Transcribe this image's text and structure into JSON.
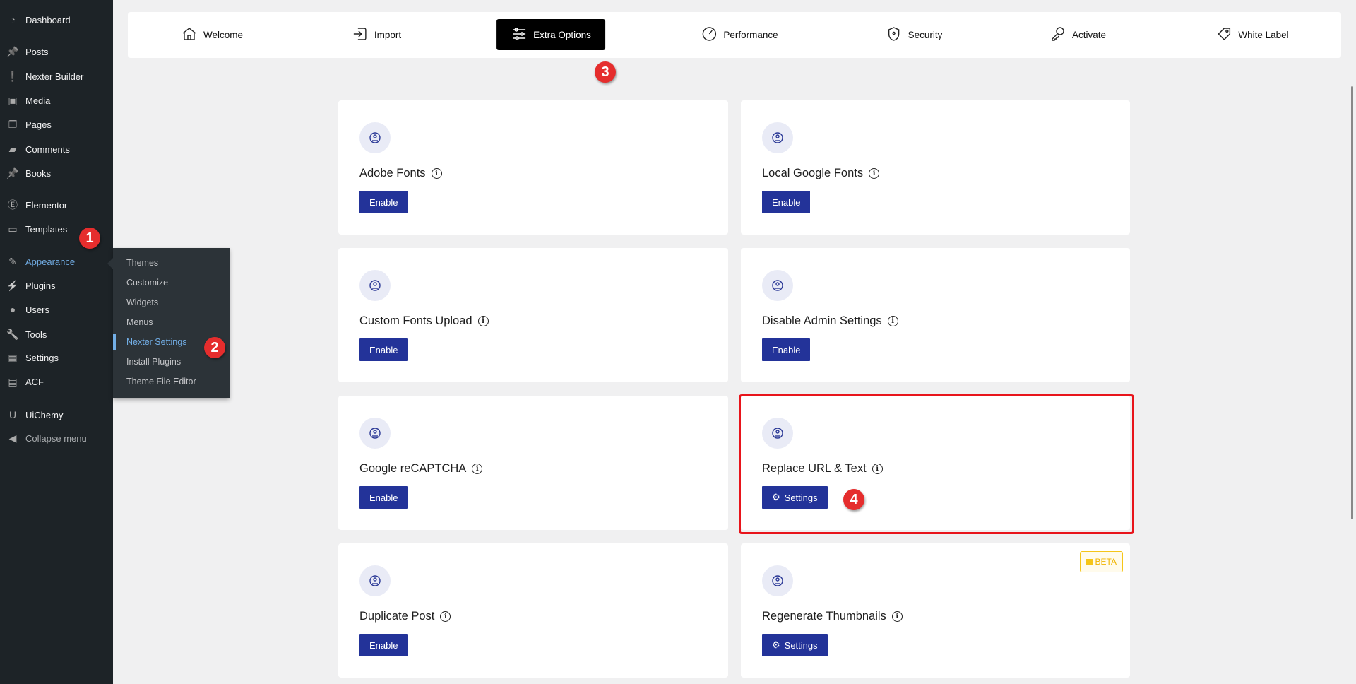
{
  "sidebar": {
    "items": [
      {
        "label": "Dashboard",
        "icon": "dashboard-icon"
      },
      {
        "label": "Posts",
        "icon": "pin-icon"
      },
      {
        "label": "Nexter Builder",
        "icon": "nexter-icon"
      },
      {
        "label": "Media",
        "icon": "media-icon"
      },
      {
        "label": "Pages",
        "icon": "pages-icon"
      },
      {
        "label": "Comments",
        "icon": "comment-icon"
      },
      {
        "label": "Books",
        "icon": "pin-icon"
      },
      {
        "label": "Elementor",
        "icon": "elementor-icon"
      },
      {
        "label": "Templates",
        "icon": "folder-icon"
      },
      {
        "label": "Appearance",
        "icon": "brush-icon",
        "active": true
      },
      {
        "label": "Plugins",
        "icon": "plugin-icon"
      },
      {
        "label": "Users",
        "icon": "user-icon"
      },
      {
        "label": "Tools",
        "icon": "wrench-icon"
      },
      {
        "label": "Settings",
        "icon": "settings-icon"
      },
      {
        "label": "ACF",
        "icon": "acf-icon"
      },
      {
        "label": "UiChemy",
        "icon": "uichemy-icon"
      },
      {
        "label": "Collapse menu",
        "icon": "collapse-icon"
      }
    ],
    "submenu": [
      {
        "label": "Themes"
      },
      {
        "label": "Customize"
      },
      {
        "label": "Widgets"
      },
      {
        "label": "Menus"
      },
      {
        "label": "Nexter Settings",
        "current": true
      },
      {
        "label": "Install Plugins"
      },
      {
        "label": "Theme File Editor"
      }
    ]
  },
  "tabs": [
    {
      "label": "Welcome",
      "icon": "home-icon"
    },
    {
      "label": "Import",
      "icon": "import-icon"
    },
    {
      "label": "Extra Options",
      "icon": "sliders-icon",
      "active": true
    },
    {
      "label": "Performance",
      "icon": "gauge-icon"
    },
    {
      "label": "Security",
      "icon": "shield-icon"
    },
    {
      "label": "Activate",
      "icon": "key-icon"
    },
    {
      "label": "White Label",
      "icon": "tag-icon"
    }
  ],
  "cards": [
    {
      "title": "Adobe Fonts",
      "button": "Enable",
      "icon": "adobe-fonts-icon"
    },
    {
      "title": "Local Google Fonts",
      "button": "Enable",
      "icon": "google-fonts-icon"
    },
    {
      "title": "Custom Fonts Upload",
      "button": "Enable",
      "icon": "font-upload-icon"
    },
    {
      "title": "Disable Admin Settings",
      "button": "Enable",
      "icon": "admin-settings-icon"
    },
    {
      "title": "Google reCAPTCHA",
      "button": "Enable",
      "icon": "recaptcha-shield-icon"
    },
    {
      "title": "Replace URL & Text",
      "button": "Settings",
      "icon": "replace-url-icon",
      "button_icon": "gear-icon"
    },
    {
      "title": "Duplicate Post",
      "button": "Enable",
      "icon": "duplicate-icon"
    },
    {
      "title": "Regenerate Thumbnails",
      "button": "Settings",
      "icon": "regenerate-image-icon",
      "button_icon": "gear-icon",
      "badge": "BETA"
    }
  ],
  "annotations": [
    "1",
    "2",
    "3",
    "4"
  ],
  "colors": {
    "sidebar": "#1d2327",
    "accent": "#233399",
    "highlight": "#e8141b",
    "annotation": "#e52d2d",
    "beta": "#f5c518"
  }
}
